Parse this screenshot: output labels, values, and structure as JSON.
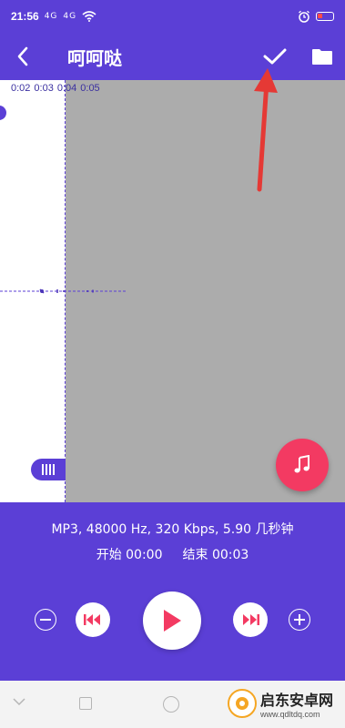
{
  "status_bar": {
    "time": "21:56",
    "signal1": "4G",
    "signal2": "4G"
  },
  "app_bar": {
    "title": "呵呵哒"
  },
  "timeline": {
    "ticks": [
      "0:02",
      "0:03",
      "0:04",
      "0:05"
    ]
  },
  "controls": {
    "file_info": "MP3, 48000 Hz, 320 Kbps, 5.90 几秒钟",
    "start_label": "开始 00:00",
    "end_label": "结束 00:03"
  },
  "watermark": {
    "name": "启东安卓网",
    "url": "www.qdltdq.com"
  },
  "colors": {
    "primary": "#5b3fd6",
    "accent": "#f33a62",
    "selection_overlay": "#acacac"
  },
  "icons": {
    "back": "back-arrow-icon",
    "confirm": "check-icon",
    "folder": "folder-icon",
    "music": "music-note-icon",
    "play": "play-icon",
    "skip_back": "skip-back-icon",
    "skip_forward": "skip-forward-icon",
    "zoom_out": "minus-icon",
    "zoom_in": "plus-icon"
  }
}
